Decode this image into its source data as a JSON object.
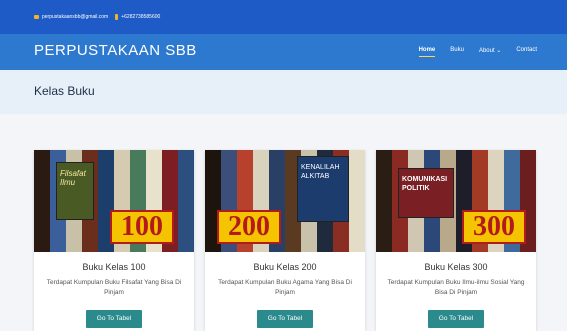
{
  "topbar": {
    "email": "perpustakaansbb@gmail.com",
    "phone": "+6282738585600"
  },
  "nav": {
    "brand": "PERPUSTAKAAN SBB",
    "items": [
      {
        "label": "Home",
        "active": true
      },
      {
        "label": "Buku",
        "active": false
      },
      {
        "label": "About ⌄",
        "active": false
      },
      {
        "label": "Contact",
        "active": false
      }
    ]
  },
  "page": {
    "title": "Kelas Buku"
  },
  "cards": [
    {
      "image_number": "100",
      "cover_text": "Filsafat Ilmu",
      "title": "Buku Kelas 100",
      "description": "Terdapat Kumpulan Buku Filsafat Yang Bisa Di Pinjam",
      "button": "Go To Tabel"
    },
    {
      "image_number": "200",
      "cover_text": "KENALILAH ALKITAB",
      "title": "Buku Kelas 200",
      "description": "Terdapat Kumpulan Buku Agama Yang Bisa Di Pinjam",
      "button": "Go To Tabel"
    },
    {
      "image_number": "300",
      "cover_text": "KOMUNIKASI POLITIK",
      "title": "Buku Kelas 300",
      "description": "Terdapat Kumpulan Buku Ilmu-ilmu Sosial Yang Bisa Di Pinjam",
      "button": "Go To Tabel"
    }
  ],
  "colors": {
    "topbar": "#1f5bc7",
    "navbar": "#2e79d0",
    "button": "#2a8a8c",
    "badge": "#f5c400"
  }
}
